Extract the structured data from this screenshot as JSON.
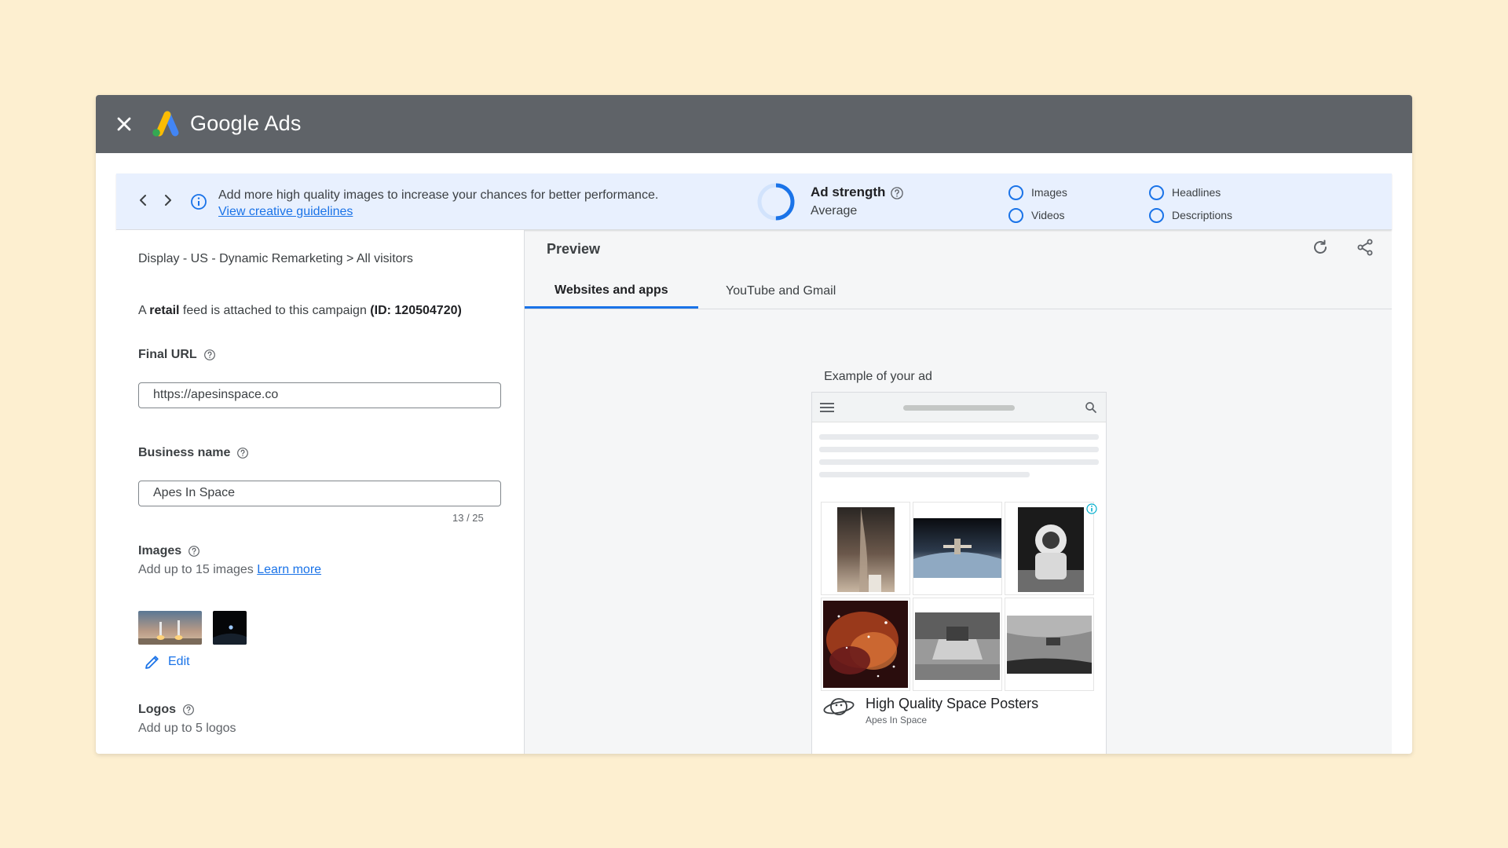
{
  "app": {
    "title": "Google Ads",
    "close_icon": "close-icon",
    "logo_icon": "google-ads-logo-icon"
  },
  "banner": {
    "message": "Add more high quality images to increase your chances for better performance.",
    "link": "View creative guidelines",
    "ad_strength_label": "Ad strength",
    "ad_strength_value": "Average",
    "ad_strength_fraction": 0.5,
    "requirements": [
      "Images",
      "Headlines",
      "Videos",
      "Descriptions"
    ]
  },
  "form": {
    "breadcrumb": "Display - US - Dynamic Remarketing > All visitors",
    "feed_prefix": "A ",
    "feed_bold": "retail",
    "feed_middle": " feed is attached to this campaign ",
    "feed_id": "(ID: 120504720)",
    "final_url_label": "Final URL",
    "final_url_value": "https://apesinspace.co",
    "business_name_label": "Business name",
    "business_name_value": "Apes In Space",
    "business_name_counter": "13 / 25",
    "images_label": "Images",
    "images_hint": "Add up to 15 images",
    "images_learn_more": "Learn more",
    "edit_label": "Edit",
    "logos_label": "Logos",
    "logos_hint": "Add up to 5 logos"
  },
  "preview": {
    "title": "Preview",
    "tabs": [
      "Websites and apps",
      "YouTube and Gmail"
    ],
    "example_label": "Example of your ad",
    "ad_headline": "High Quality Space Posters",
    "ad_business": "Apes In Space"
  },
  "colors": {
    "accent": "#1a73e8",
    "titlebar": "#5f6368",
    "banner": "#e8f0fe",
    "page": "#fdefd0"
  }
}
